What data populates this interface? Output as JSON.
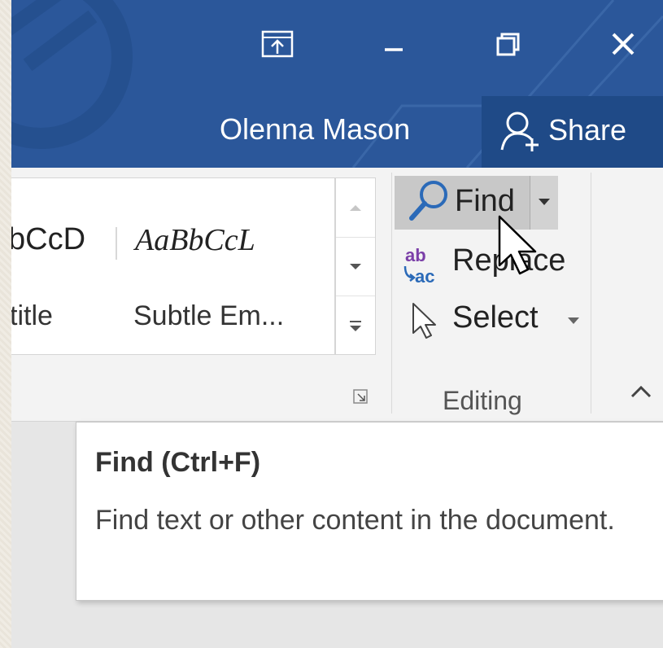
{
  "titlebar": {
    "user_name": "Olenna Mason",
    "share_label": "Share",
    "color": "#2b579a",
    "buttons": [
      {
        "name": "ribbon-display-options-icon"
      },
      {
        "name": "minimize-icon"
      },
      {
        "name": "restore-icon"
      },
      {
        "name": "close-icon"
      }
    ]
  },
  "ribbon": {
    "styles_gallery": {
      "items": [
        {
          "sample": "bCcD",
          "label": "title"
        },
        {
          "sample": "AaBbCcL",
          "label": "Subtle Em..."
        }
      ]
    },
    "editing": {
      "group_label": "Editing",
      "find_label": "Find",
      "replace_label": "Replace",
      "select_label": "Select",
      "replace_icon_text": {
        "top": "ab",
        "bottom": "ac"
      }
    }
  },
  "tooltip": {
    "title": "Find (Ctrl+F)",
    "description": "Find text or other content in the document."
  }
}
